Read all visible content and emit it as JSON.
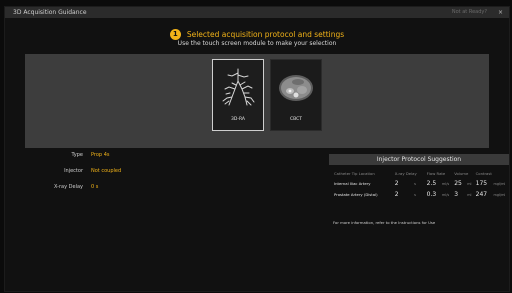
{
  "window": {
    "title": "3D Acquisition Guidance",
    "hint": "Not at Ready?",
    "close_glyph": "×"
  },
  "header": {
    "step_number": "1",
    "title": "Selected acquisition protocol and settings",
    "subtitle": "Use the touch screen module to make your selection"
  },
  "protocols": [
    {
      "label": "3D-RA",
      "selected": true,
      "icon": "angiography-vessel-icon"
    },
    {
      "label": "CBCT",
      "selected": false,
      "icon": "cbct-slice-icon"
    }
  ],
  "settings": {
    "type_label": "Type",
    "type_value": "Prop 4s",
    "injector_label": "Injector",
    "injector_value": "Not coupled",
    "xray_delay_label": "X-ray Delay",
    "xray_delay_value": "0 s"
  },
  "injector_suggestion": {
    "title": "Injector Protocol Suggestion",
    "columns": [
      "Catheter Tip Location",
      "X-ray Delay",
      "Flow Rate",
      "Volume",
      "Contrast"
    ],
    "rows": [
      {
        "location": "Internal Iliac Artery",
        "delay": "2",
        "delay_unit": "s",
        "flow": "2.5",
        "flow_unit": "ml/s",
        "volume": "25",
        "volume_unit": "ml",
        "contrast": "175",
        "contrast_unit": "mgI/ml"
      },
      {
        "location": "Prostate Artery (Distal)",
        "delay": "2",
        "delay_unit": "s",
        "flow": "0.3",
        "flow_unit": "ml/s",
        "volume": "3",
        "volume_unit": "ml",
        "contrast": "247",
        "contrast_unit": "mgI/ml"
      }
    ],
    "footnote": "For more information, refer to the Instructions for Use"
  },
  "colors": {
    "accent": "#f2b318",
    "panel": "#3d3d3d",
    "background": "#111111"
  }
}
